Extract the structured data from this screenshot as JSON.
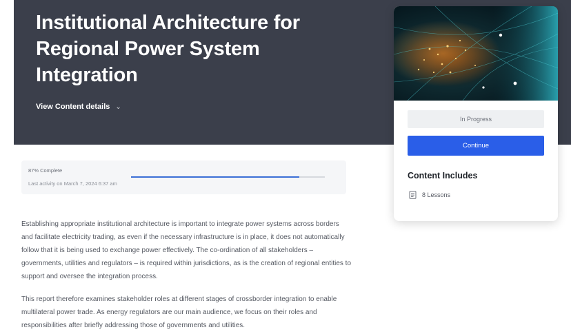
{
  "course": {
    "title": "Institutional Architecture for Regional Power System Integration",
    "details_toggle": "View Content details"
  },
  "progress": {
    "percent_label": "87% Complete",
    "percent_value": 87,
    "last_activity": "Last activity on March 7, 2024 6:37 am"
  },
  "description": [
    "Establishing appropriate institutional architecture is important to integrate power systems across borders and facilitate electricity trading, as even if the necessary infrastructure is in place, it does not automatically follow that it is being used to exchange power effectively. The co-ordination of all stakeholders – governments, utilities and regulators – is required within jurisdictions, as is the creation of regional entities to support and oversee the integration process.",
    "This report therefore examines stakeholder roles at different stages of crossborder integration to enable multilateral power trade. As energy regulators are our main audience, we focus on their roles and responsibilities after briefly addressing those of governments and utilities."
  ],
  "sidebar_card": {
    "status": "In Progress",
    "continue_label": "Continue",
    "includes_heading": "Content Includes",
    "lessons": "8 Lessons"
  },
  "icons": {
    "details": "chevron-down-icon",
    "lessons": "document-icon"
  },
  "colors": {
    "hero_bg": "#3b3f4b",
    "primary": "#2a5ee8",
    "progress": "#3b6fd6"
  }
}
